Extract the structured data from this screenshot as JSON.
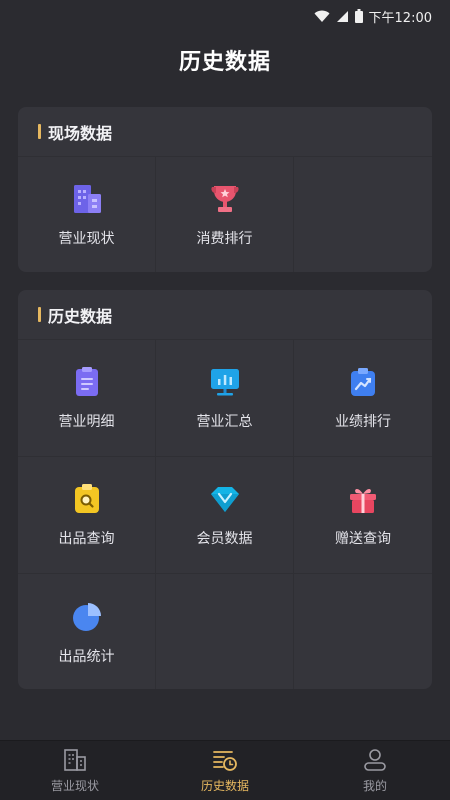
{
  "status_bar": {
    "time": "下午12:00"
  },
  "page": {
    "title": "历史数据"
  },
  "live_section": {
    "title": "现场数据",
    "items": [
      {
        "label": "营业现状",
        "icon": "building-icon"
      },
      {
        "label": "消费排行",
        "icon": "trophy-icon"
      }
    ]
  },
  "history_section": {
    "title": "历史数据",
    "items": [
      {
        "label": "营业明细",
        "icon": "document-list-icon"
      },
      {
        "label": "营业汇总",
        "icon": "monitor-chart-icon"
      },
      {
        "label": "业绩排行",
        "icon": "trend-clipboard-icon"
      },
      {
        "label": "出品查询",
        "icon": "search-clipboard-icon"
      },
      {
        "label": "会员数据",
        "icon": "diamond-icon"
      },
      {
        "label": "赠送查询",
        "icon": "gift-icon"
      },
      {
        "label": "出品统计",
        "icon": "pie-chart-icon"
      }
    ]
  },
  "tabbar": {
    "tabs": [
      {
        "label": "营业现状",
        "icon": "building-outline-icon",
        "active": false
      },
      {
        "label": "历史数据",
        "icon": "history-list-icon",
        "active": true
      },
      {
        "label": "我的",
        "icon": "user-icon",
        "active": false
      }
    ]
  },
  "colors": {
    "accent": "#e6b860",
    "background": "#2b2b30",
    "card": "#35353b"
  }
}
